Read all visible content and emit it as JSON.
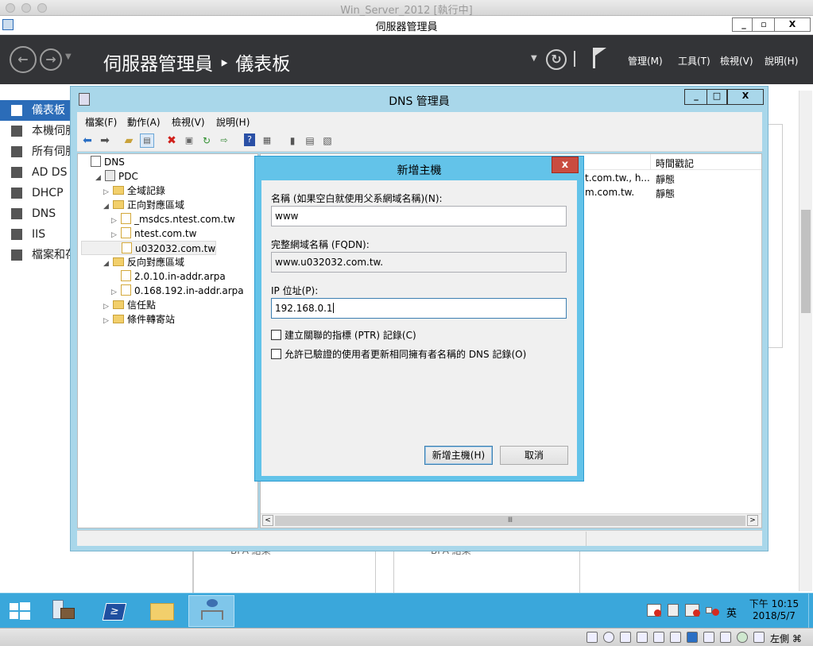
{
  "vm_title": "Win_Server_2012 [執行中]",
  "server_manager": {
    "window_title": "伺服器管理員",
    "breadcrumb": "伺服器管理員 ‣ 儀表板",
    "menus": [
      "管理(M)",
      "工具(T)",
      "檢視(V)",
      "說明(H)"
    ],
    "sidebar": [
      "儀表板",
      "本機伺服器",
      "所有伺服器",
      "AD DS",
      "DHCP",
      "DNS",
      "IIS",
      "檔案和存放服務"
    ],
    "bg_label_1": "BPA 結果",
    "bg_label_2": "BPA 結果"
  },
  "dns_manager": {
    "title": "DNS 管理員",
    "menus": [
      "檔案(F)",
      "動作(A)",
      "檢視(V)",
      "說明(H)"
    ],
    "tree": [
      {
        "label": "DNS",
        "level": 0,
        "twisty": ""
      },
      {
        "label": "PDC",
        "level": 1,
        "twisty": "◢"
      },
      {
        "label": "全域記錄",
        "level": 2,
        "twisty": "▷"
      },
      {
        "label": "正向對應區域",
        "level": 2,
        "twisty": "◢"
      },
      {
        "label": "_msdcs.ntest.com.tw",
        "level": 3,
        "twisty": "▷"
      },
      {
        "label": "ntest.com.tw",
        "level": 3,
        "twisty": "▷"
      },
      {
        "label": "u032032.com.tw",
        "level": 3,
        "twisty": ""
      },
      {
        "label": "反向對應區域",
        "level": 2,
        "twisty": "◢"
      },
      {
        "label": "2.0.10.in-addr.arpa",
        "level": 3,
        "twisty": ""
      },
      {
        "label": "0.168.192.in-addr.arpa",
        "level": 3,
        "twisty": "▷"
      },
      {
        "label": "信任點",
        "level": 2,
        "twisty": "▷"
      },
      {
        "label": "條件轉寄站",
        "level": 2,
        "twisty": "▷"
      }
    ],
    "list_header_timestamp": "時間戳記",
    "list_rows": [
      {
        "data": "t.com.tw., h...",
        "timestamp": "靜態"
      },
      {
        "data": "m.com.tw.",
        "timestamp": "靜態"
      }
    ]
  },
  "dialog": {
    "title": "新增主機",
    "close": "x",
    "name_label": "名稱 (如果空白就使用父系網域名稱)(N):",
    "name_value": "www",
    "fqdn_label": "完整網域名稱 (FQDN):",
    "fqdn_value": "www.u032032.com.tw.",
    "ip_label": "IP 位址(P):",
    "ip_value": "192.168.0.1",
    "ptr_label": "建立關聯的指標 (PTR) 記錄(C)",
    "auth_label": "允許已驗證的使用者更新相同擁有者名稱的 DNS 記錄(O)",
    "add_button": "新增主機(H)",
    "cancel_button": "取消"
  },
  "taskbar": {
    "time": "下午 10:15",
    "date": "2018/5/7",
    "ime": "英"
  },
  "vm_status": {
    "host_key": "左側 ⌘"
  }
}
